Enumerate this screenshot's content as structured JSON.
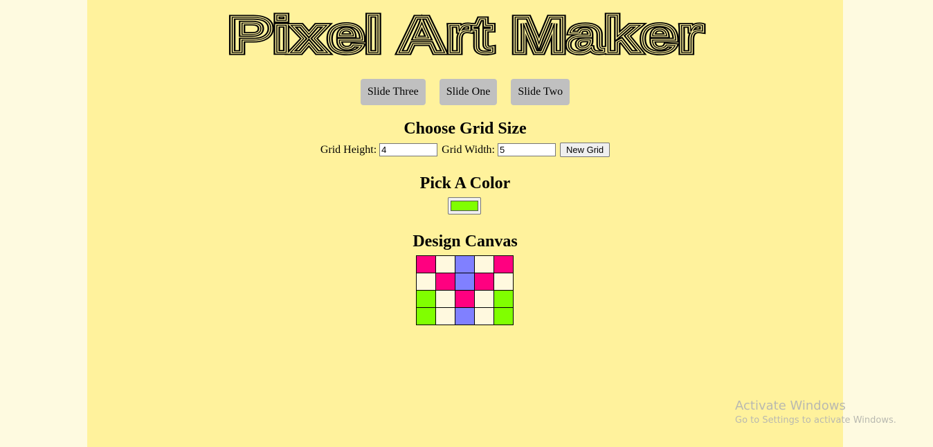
{
  "app": {
    "title": "Pixel Art Maker"
  },
  "slides": {
    "buttons": [
      "Slide Three",
      "Slide One",
      "Slide Two"
    ]
  },
  "grid_size": {
    "heading": "Choose Grid Size",
    "height_label": "Grid Height:",
    "height_value": "4",
    "width_label": "Grid Width:",
    "width_value": "5",
    "submit_label": "New Grid"
  },
  "color": {
    "heading": "Pick A Color",
    "value": "#80ff00"
  },
  "canvas": {
    "heading": "Design Canvas",
    "rows": [
      [
        "#ff0080",
        "#fff9df",
        "#8080ff",
        "#fff9df",
        "#ff0080"
      ],
      [
        "#fff9df",
        "#ff0080",
        "#8080ff",
        "#ff0080",
        "#fff9df"
      ],
      [
        "#80ff00",
        "#fff9df",
        "#ff0080",
        "#fff9df",
        "#80ff00"
      ],
      [
        "#80ff00",
        "#fff9df",
        "#8080ff",
        "#fff9df",
        "#80ff00"
      ]
    ]
  },
  "watermark": {
    "title": "Activate Windows",
    "subtitle": "Go to Settings to activate Windows."
  },
  "colors": {
    "page_bg": "#fefae0",
    "main_bg": "#fff29c",
    "slide_button_bg": "#c0c0c0"
  }
}
